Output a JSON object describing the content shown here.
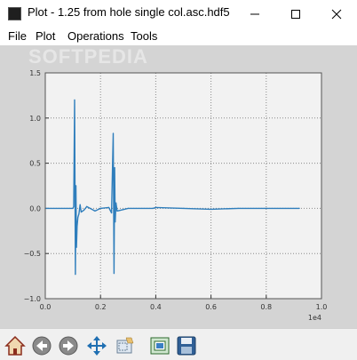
{
  "window": {
    "title": "Plot - 1.25 from hole single col.asc.hdf5"
  },
  "menu": {
    "file": "File",
    "plot": "Plot",
    "operations": "Operations",
    "tools": "Tools"
  },
  "watermark": "SOFTPEDIA",
  "toolbar_icons": [
    "home-icon",
    "back-icon",
    "forward-icon",
    "pan-icon",
    "zoom-icon",
    "configure-subplots-icon",
    "save-icon"
  ],
  "chart_data": {
    "type": "line",
    "x_ticks": [
      "0.0",
      "0.2",
      "0.4",
      "0.6",
      "0.8",
      "1.0"
    ],
    "y_ticks": [
      "1.5",
      "1.0",
      "0.5",
      "0.0",
      "−0.5",
      "−1.0"
    ],
    "x_offset_label": "1e4",
    "xlim": [
      0,
      10000
    ],
    "ylim": [
      -1.0,
      1.5
    ],
    "grid": true,
    "line_color": "#2f7ebc",
    "series": [
      {
        "x": [
          0,
          1000,
          1030,
          1060,
          1090,
          1110,
          1130,
          1150,
          1180,
          1220,
          1260,
          1300,
          1400,
          1500,
          1800,
          2000,
          2300,
          2400,
          2460,
          2490,
          2510,
          2530,
          2560,
          2600,
          3000,
          3900,
          4000,
          5000,
          6000,
          7000,
          8000,
          9200
        ],
        "y": [
          0,
          0,
          0.02,
          1.2,
          -0.73,
          0.25,
          -0.43,
          -0.2,
          -0.1,
          -0.06,
          0.04,
          -0.04,
          -0.02,
          0.02,
          -0.03,
          0,
          0.01,
          -0.05,
          0.83,
          -0.72,
          0.45,
          -0.15,
          0.06,
          -0.03,
          0,
          0,
          0.01,
          0,
          -0.01,
          0,
          0,
          0
        ]
      }
    ]
  }
}
